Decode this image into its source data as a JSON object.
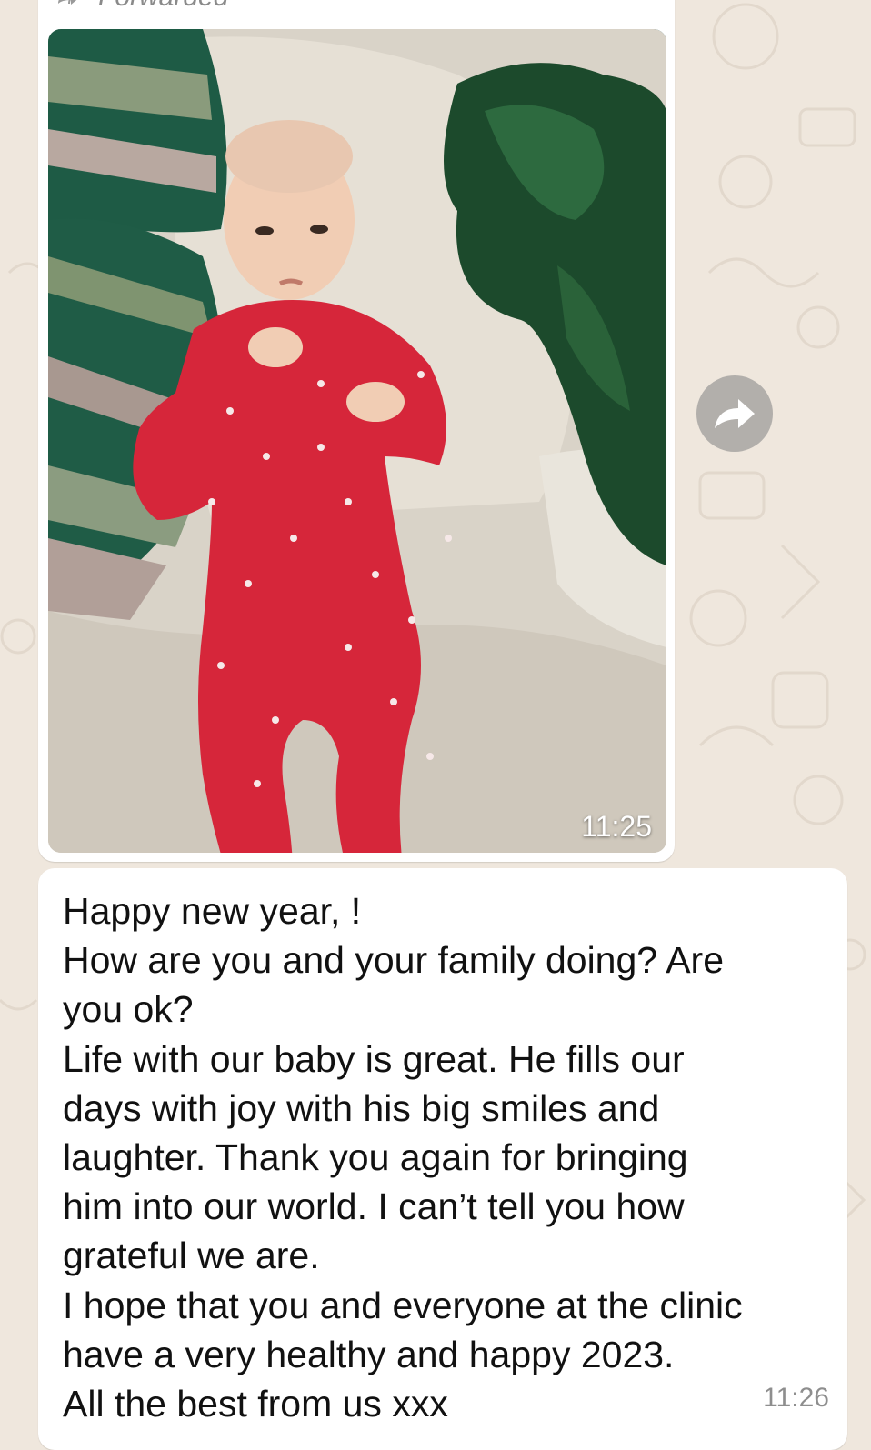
{
  "wallpaper": {
    "color": "#efe7dd"
  },
  "forwarded_message": {
    "header_label": "Forwarded",
    "image_description_icon": "photo",
    "timestamp": "11:25"
  },
  "share_button": {
    "icon": "forward-arrow-icon"
  },
  "text_message": {
    "lines": [
      "Happy new year, !",
      "How are you and your family doing? Are",
      "you ok?",
      "Life with our baby is great. He fills our",
      "days with joy with his big smiles and",
      "laughter. Thank you again for bringing",
      "him into our world. I can’t tell you how",
      "grateful we are.",
      "I hope that you and everyone at the clinic",
      "have a very healthy and happy 2023.",
      "All the best from us xxx"
    ],
    "timestamp": "11:26"
  }
}
